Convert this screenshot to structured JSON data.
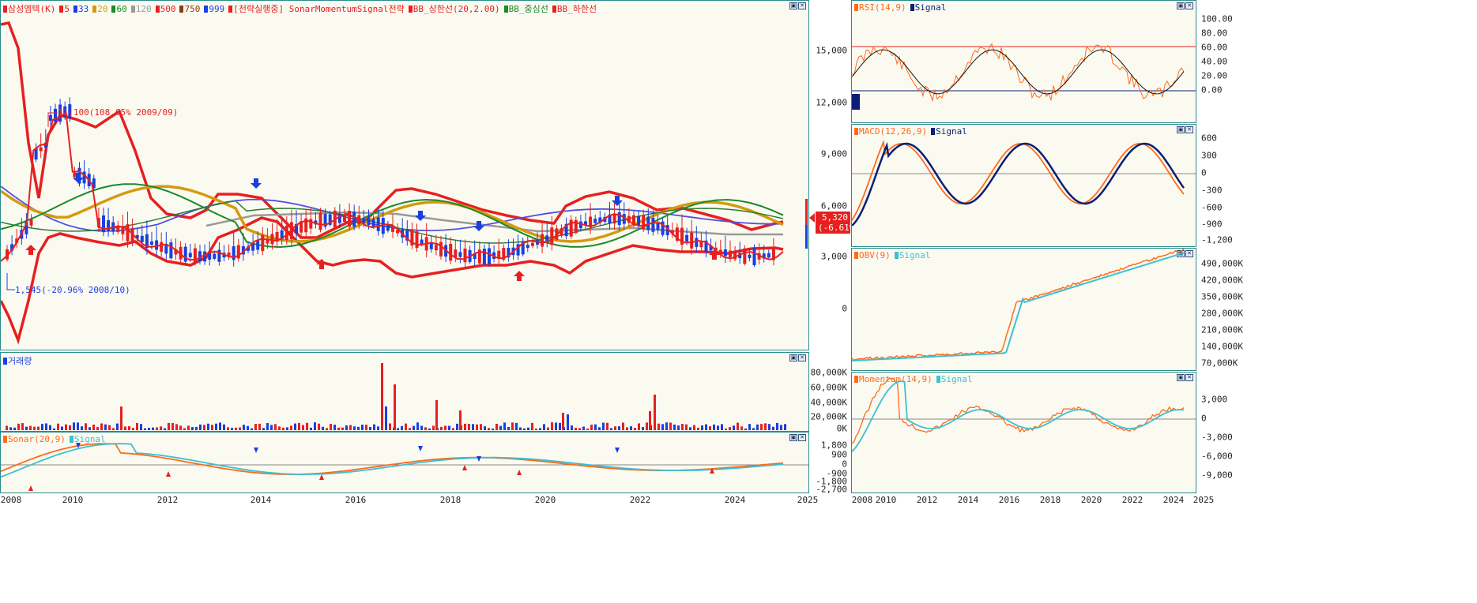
{
  "colors": {
    "red": "#e62020",
    "blue": "#1a3fe0",
    "navy": "#0b1f73",
    "orange": "#ff6a1a",
    "cyan": "#3cc0d0",
    "green": "#1a8a2a",
    "gold": "#d49a10",
    "gray": "#9a9a9a",
    "violet": "#5050e0",
    "frame": "#2a8c8c"
  },
  "main": {
    "legend": [
      {
        "label": "삼성엠텍(K)",
        "color": "#e62020"
      },
      {
        "label": "5",
        "color": "#e62020"
      },
      {
        "label": "33",
        "color": "#1a3fe0"
      },
      {
        "label": "20",
        "color": "#d49a10"
      },
      {
        "label": "60",
        "color": "#1a8a2a"
      },
      {
        "label": "120",
        "color": "#9a9a9a"
      },
      {
        "label": "500",
        "color": "#e62020"
      },
      {
        "label": "750",
        "color": "#8a3a1a"
      },
      {
        "label": "999",
        "color": "#1a3fe0"
      },
      {
        "label": "[전략실행중] SonarMomentumSignal전략",
        "color": "#e62020"
      },
      {
        "label": "BB_상한선(20,2.00)",
        "color": "#e62020"
      },
      {
        "label": "BB_중심선",
        "color": "#1a8a2a"
      },
      {
        "label": "BB_하한선",
        "color": "#e62020"
      }
    ],
    "y_ticks": [
      "15,000",
      "12,000",
      "9,000",
      "6,000",
      "3,000",
      "0"
    ],
    "high_annotation": "11,100(108.65% 2009/09)",
    "low_annotation": "1,545(-20.96% 2008/10)",
    "price_badge_value": "5,320",
    "price_badge_change": "(-6.61%)"
  },
  "volume": {
    "legend": [
      {
        "label": "거래량",
        "color": "#1a3fe0"
      }
    ],
    "y_ticks": [
      "80,000K",
      "60,000K",
      "40,000K",
      "20,000K",
      "0K"
    ]
  },
  "sonar": {
    "legend": [
      {
        "label": "Sonar(20,9)",
        "color": "#ff6a1a"
      },
      {
        "label": "Signal",
        "color": "#3cc0d0"
      }
    ],
    "y_ticks": [
      "1,800",
      "900",
      "0",
      "-900",
      "-1,800",
      "-2,700"
    ]
  },
  "main_x_ticks": [
    "2008",
    "2010",
    "2012",
    "2014",
    "2016",
    "2018",
    "2020",
    "2022",
    "2024",
    "2025"
  ],
  "right_x_ticks": [
    "2008",
    "2010",
    "2012",
    "2014",
    "2016",
    "2018",
    "2020",
    "2022",
    "2024",
    "2025"
  ],
  "rsi": {
    "legend": [
      {
        "label": "RSI(14,9)",
        "color": "#ff6a1a"
      },
      {
        "label": "Signal",
        "color": "#0b1f73"
      }
    ],
    "y_ticks": [
      "100.00",
      "80.00",
      "60.00",
      "40.00",
      "20.00",
      "0.00"
    ]
  },
  "macd": {
    "legend": [
      {
        "label": "MACD(12,26,9)",
        "color": "#ff6a1a"
      },
      {
        "label": "Signal",
        "color": "#0b1f73"
      }
    ],
    "y_ticks": [
      "600",
      "300",
      "0",
      "-300",
      "-600",
      "-900",
      "-1,200"
    ]
  },
  "obv": {
    "legend": [
      {
        "label": "OBV(9)",
        "color": "#ff6a1a"
      },
      {
        "label": "Signal",
        "color": "#3cc0d0"
      }
    ],
    "y_ticks": [
      "490,000K",
      "420,000K",
      "350,000K",
      "280,000K",
      "210,000K",
      "140,000K",
      "70,000K"
    ]
  },
  "momentum": {
    "legend": [
      {
        "label": "Momentum(14,9)",
        "color": "#ff6a1a"
      },
      {
        "label": "Signal",
        "color": "#3cc0d0"
      }
    ],
    "y_ticks": [
      "3,000",
      "0",
      "-3,000",
      "-6,000",
      "-9,000"
    ]
  },
  "window_buttons": {
    "restore": "▣",
    "close": "✕"
  }
}
